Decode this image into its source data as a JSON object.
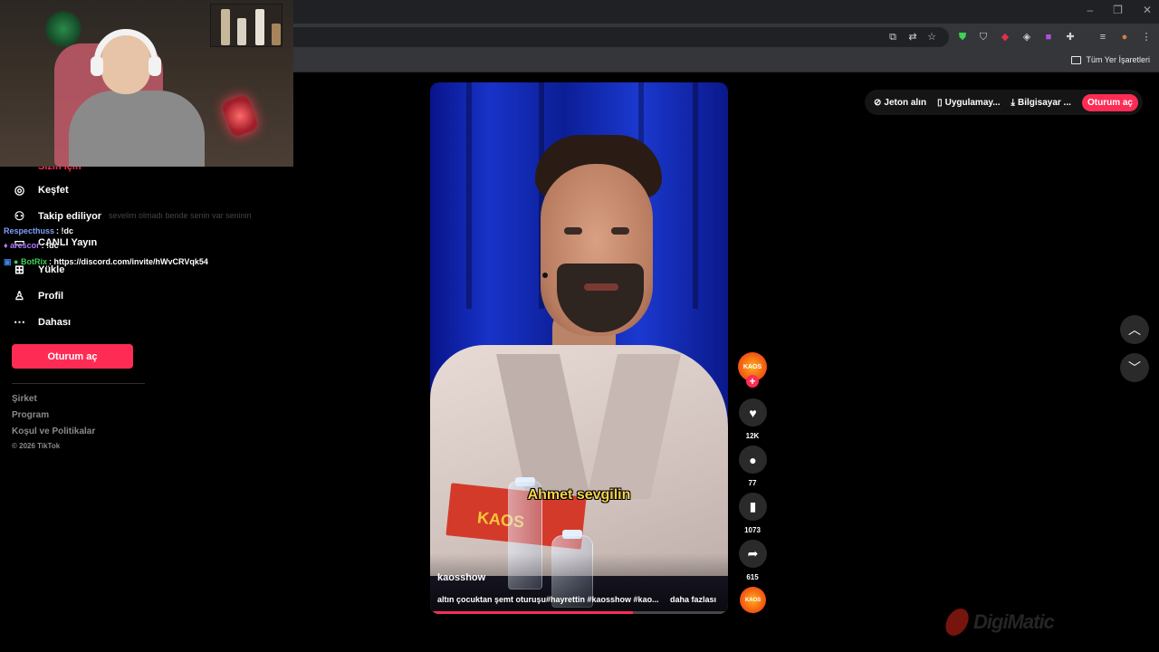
{
  "browser": {
    "bookmark_all_label": "Tüm Yer İşaretleri",
    "window_controls": [
      "–",
      "❐",
      "✕"
    ]
  },
  "sidebar": {
    "partial_item_label": "Sizin için",
    "items": [
      {
        "label": "Keşfet",
        "icon": "compass-icon"
      },
      {
        "label": "Takip ediliyor",
        "icon": "user-plus-icon"
      },
      {
        "label": "CANLI Yayın",
        "icon": "live-tv-icon"
      },
      {
        "label": "Yükle",
        "icon": "upload-plus-icon"
      },
      {
        "label": "Profil",
        "icon": "user-icon"
      },
      {
        "label": "Dahası",
        "icon": "more-dots-icon"
      }
    ],
    "login_label": "Oturum aç",
    "footer_links": [
      "Şirket",
      "Program",
      "Koşul ve Politikalar"
    ],
    "copyright": "© 2026 TikTok"
  },
  "chat": {
    "ghost_text": "sevelim olmadı bende senin var seninin",
    "messages": [
      {
        "user": "Respecthuss",
        "text": ": !dc",
        "color": "#7fa0ff"
      },
      {
        "user": "arescor",
        "text": ": !dc",
        "color": "#b07bff"
      },
      {
        "user": "BotRix",
        "text": ": https://discord.com/invite/hWvCRVqk54",
        "color": "#3cd35a"
      }
    ]
  },
  "topbar": {
    "coins_label": "Jeton alın",
    "app_label": "Uygulamay...",
    "desktop_label": "Bilgisayar ...",
    "login_label": "Oturum aç"
  },
  "video": {
    "subtitle": "Ahmet sevgilin",
    "card_text": "KAOS",
    "author": "kaosshow",
    "caption": "altın çocuktan şemt oturuşu#hayrettin #kaosshow #kao...",
    "more_label": "daha fazlası",
    "progress_fraction": 0.68
  },
  "actions": {
    "avatar_text": "KAOS",
    "likes": "12K",
    "comments": "77",
    "saves": "1073",
    "shares": "615"
  },
  "watermark": {
    "text": "DigiMatic"
  },
  "colors": {
    "accent": "#fe2c55",
    "background": "#000000"
  }
}
